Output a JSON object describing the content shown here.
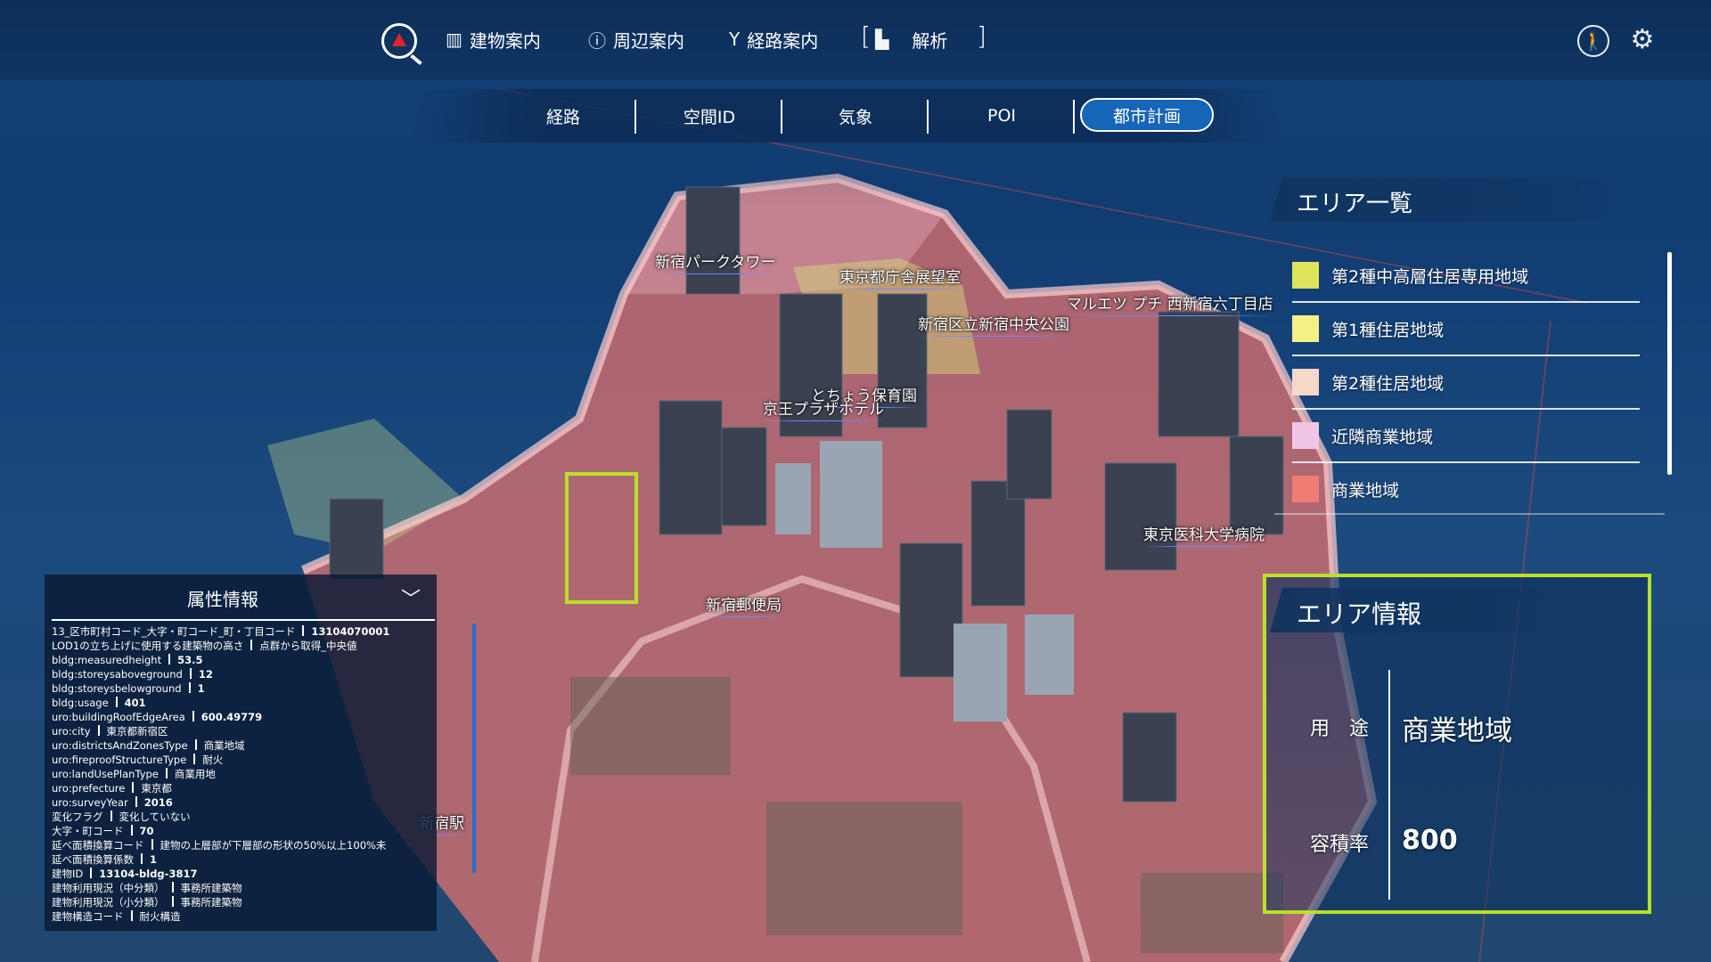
{
  "header": {
    "nav": [
      {
        "label": "建物案内",
        "icon": "building-icon"
      },
      {
        "label": "周辺案内",
        "icon": "info-icon"
      },
      {
        "label": "経路案内",
        "icon": "route-icon"
      },
      {
        "label": "解析",
        "icon": "analysis-icon"
      }
    ]
  },
  "tabs": [
    "経路",
    "空間ID",
    "気象",
    "POI",
    "都市計画"
  ],
  "active_tab": "都市計画",
  "area_list": {
    "title": "エリア一覧",
    "items": [
      {
        "label": "第2種中高層住居専用地域",
        "color": "#dde35a"
      },
      {
        "label": "第1種住居地域",
        "color": "#f6ef86"
      },
      {
        "label": "第2種住居地域",
        "color": "#f6d8c8"
      },
      {
        "label": "近隣商業地域",
        "color": "#f0c6e4"
      },
      {
        "label": "商業地域",
        "color": "#ef7d74"
      }
    ]
  },
  "area_info": {
    "title": "エリア情報",
    "use_key": "用　途",
    "use_value": "商業地域",
    "far_key": "容積率",
    "far_value": "800"
  },
  "attributes": {
    "title": "属性情報",
    "rows": [
      {
        "k": "13_区市町村コード_大字・町コード_町・丁目コード",
        "v": "13104070001"
      },
      {
        "k": "LOD1の立ち上げに使用する建築物の高さ",
        "v": "点群から取得_中央値"
      },
      {
        "k": "bldg:measuredheight",
        "v": "53.5"
      },
      {
        "k": "bldg:storeysaboveground",
        "v": "12"
      },
      {
        "k": "bldg:storeysbelowground",
        "v": "1"
      },
      {
        "k": "bldg:usage",
        "v": "401"
      },
      {
        "k": "uro:buildingRoofEdgeArea",
        "v": "600.49779"
      },
      {
        "k": "uro:city",
        "v": "東京都新宿区"
      },
      {
        "k": "uro:districtsAndZonesType",
        "v": "商業地域"
      },
      {
        "k": "uro:fireproofStructureType",
        "v": "耐火"
      },
      {
        "k": "uro:landUsePlanType",
        "v": "商業用地"
      },
      {
        "k": "uro:prefecture",
        "v": "東京都"
      },
      {
        "k": "uro:surveyYear",
        "v": "2016"
      },
      {
        "k": "変化フラグ",
        "v": "変化していない"
      },
      {
        "k": "大字・町コード",
        "v": "70"
      },
      {
        "k": "延べ面積換算コード",
        "v": "建物の上層部が下層部の形状の50%以上100%未"
      },
      {
        "k": "延べ面積換算係数",
        "v": "1"
      },
      {
        "k": "建物ID",
        "v": "13104-bldg-3817"
      },
      {
        "k": "建物利用現況（中分類）",
        "v": "事務所建築物"
      },
      {
        "k": "建物利用現況（小分類）",
        "v": "事務所建築物"
      },
      {
        "k": "建物構造コード",
        "v": "耐火構造"
      }
    ]
  },
  "map_labels": [
    "新宿パークタワー",
    "東京都庁舎展望室",
    "マルエツ プチ 西新宿六丁目店",
    "新宿区立新宿中央公園",
    "とちょう保育園",
    "京王プラザホテル",
    "東京医科大学病院",
    "新宿郵便局",
    "新宿駅"
  ]
}
